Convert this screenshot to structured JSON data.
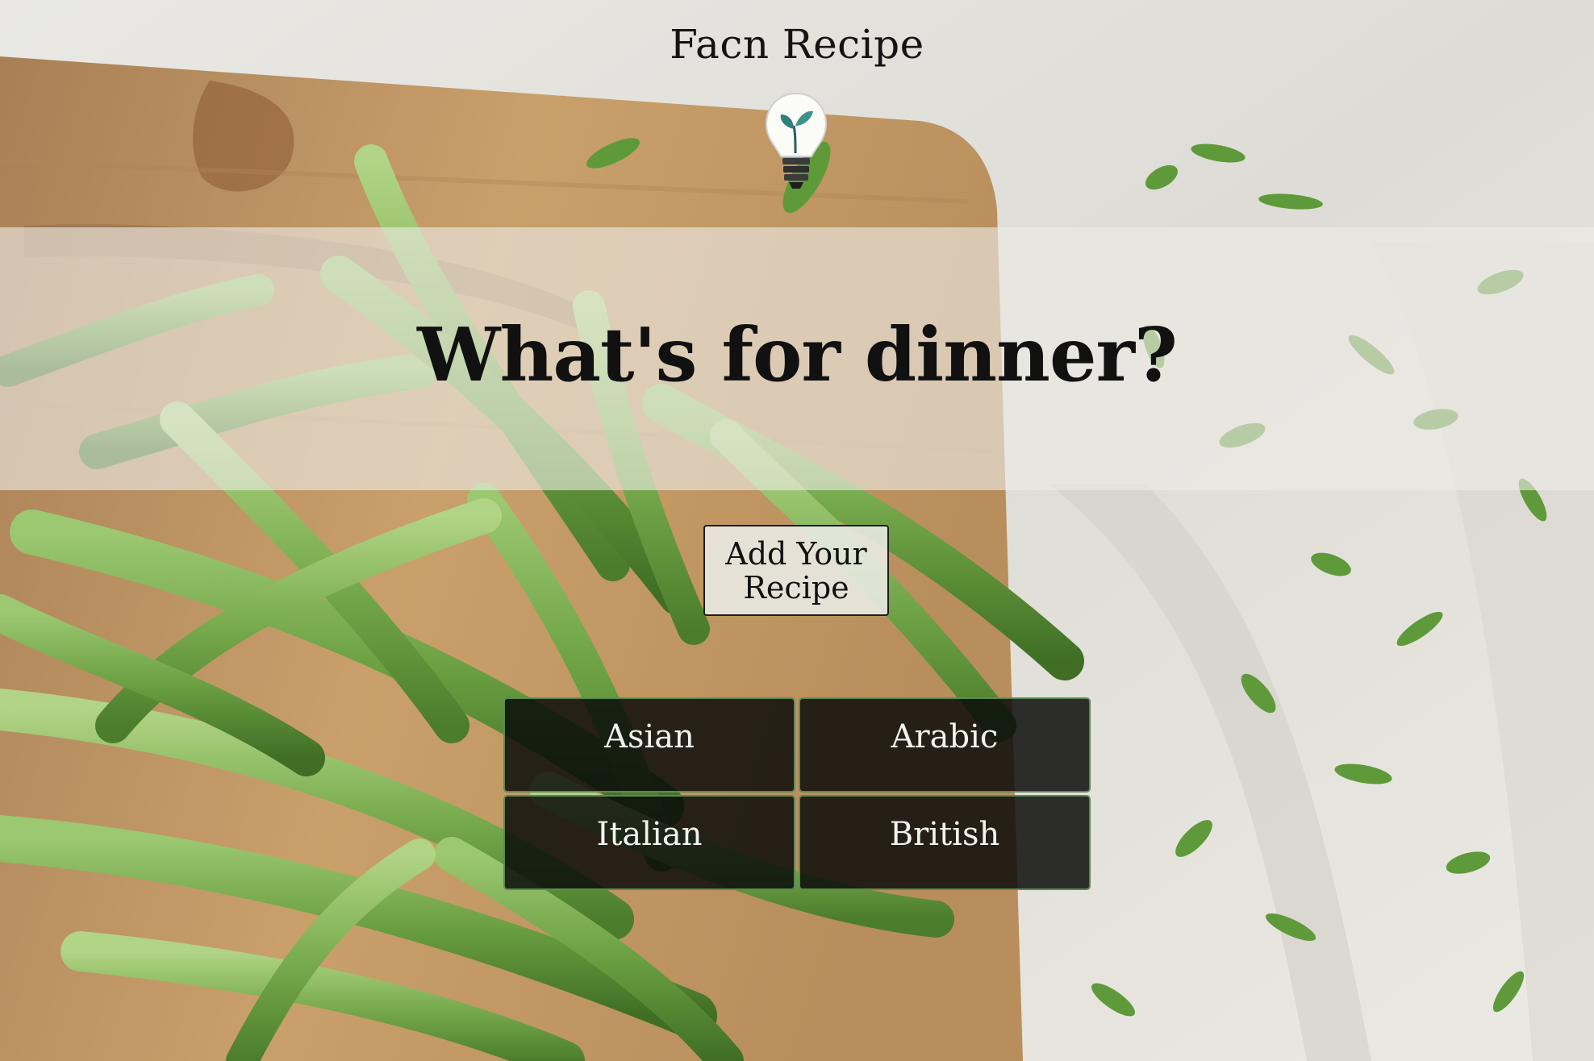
{
  "header": {
    "site_title": "Facn Recipe",
    "logo_icon": "lightbulb-sprout-icon"
  },
  "hero": {
    "title": "What's for dinner?"
  },
  "actions": {
    "add_recipe_label": "Add Your Recipe"
  },
  "cuisines": [
    {
      "label": "Asian"
    },
    {
      "label": "Arabic"
    },
    {
      "label": "Italian"
    },
    {
      "label": "British"
    }
  ],
  "colors": {
    "cuisine_tile_bg": "#0a0c0a",
    "cuisine_tile_border": "#5c8a55",
    "bean_green": "#6ea24a",
    "board_wood": "#c49a62",
    "linen": "#e8e6e0"
  },
  "background": {
    "description_icon": "green-beans-on-cutting-board-photo"
  }
}
